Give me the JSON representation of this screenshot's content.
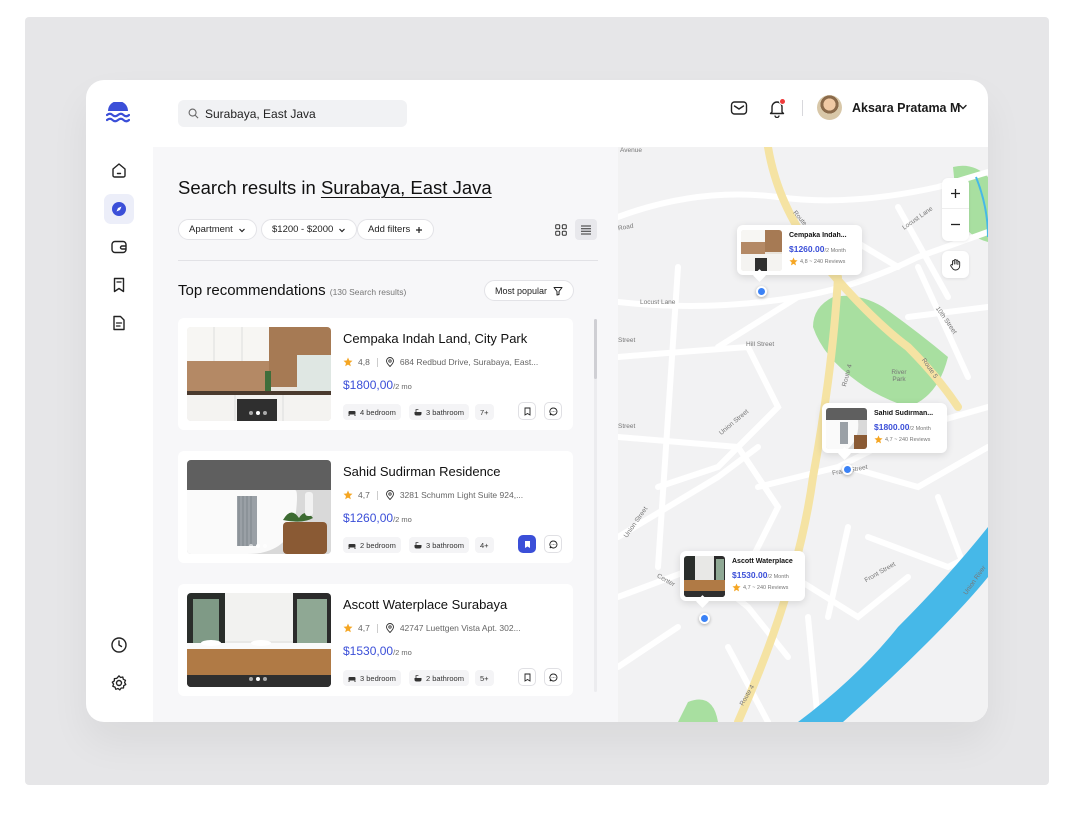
{
  "header": {
    "search_value": "Surabaya, East Java",
    "user_name": "Aksara Pratama M",
    "notification_dot": true
  },
  "sidebar": {
    "items": [
      {
        "icon": "home-icon",
        "active": false
      },
      {
        "icon": "compass-icon",
        "active": true
      },
      {
        "icon": "wallet-icon",
        "active": false
      },
      {
        "icon": "bookmark-icon",
        "active": false
      },
      {
        "icon": "document-icon",
        "active": false
      }
    ],
    "bottom": [
      {
        "icon": "clock-icon"
      },
      {
        "icon": "settings-icon"
      }
    ]
  },
  "results": {
    "title_prefix": "Search results in ",
    "location": "Surabaya, East Java",
    "filters": {
      "type": "Apartment",
      "price": "$1200 - $2000",
      "add": "Add filters"
    },
    "section_title": "Top recommendations",
    "result_count": "(130 Search results)",
    "sort_label": "Most popular"
  },
  "listings": [
    {
      "name": "Cempaka Indah Land, City Park",
      "rating": "4,8",
      "address": "684 Redbud Drive, Surabaya, East...",
      "price": "$1800,00",
      "period": "/2 mo",
      "bedroom": "4 bedroom",
      "bathroom": "3 bathroom",
      "more": "7+",
      "bookmarked": false
    },
    {
      "name": "Sahid Sudirman Residence",
      "rating": "4,7",
      "address": "3281 Schumm Light Suite 924,...",
      "price": "$1260,00",
      "period": "/2 mo",
      "bedroom": "2 bedroom",
      "bathroom": "3 bathroom",
      "more": "4+",
      "bookmarked": true
    },
    {
      "name": "Ascott Waterplace Surabaya",
      "rating": "4,7",
      "address": "42747 Luettgen Vista Apt. 302...",
      "price": "$1530,00",
      "period": "/2 mo",
      "bedroom": "3 bedroom",
      "bathroom": "2 bathroom",
      "more": "5+",
      "bookmarked": false
    }
  ],
  "map": {
    "streets": [
      "Avenue",
      "Road",
      "Locust Lane",
      "Locust Lane",
      "Hill Street",
      "Union Street",
      "Union Street",
      "Street",
      "Route 4",
      "Route 4",
      "Route 4",
      "River Park",
      "10th Street",
      "Route 5",
      "Frank Street",
      "Center",
      "Front Street",
      "Union River",
      "Street"
    ],
    "pins": [
      {
        "name": "Cempaka Indah...",
        "price": "$1260.00",
        "period": "/2 Month",
        "rating": "4,8 ~ 240 Reviews"
      },
      {
        "name": "Sahid Sudirman...",
        "price": "$1800.00",
        "period": "/2 Month",
        "rating": "4,7 ~ 240 Reviews"
      },
      {
        "name": "Ascott Waterplace",
        "price": "$1530.00",
        "period": "/2 Month",
        "rating": "4,7 ~ 240 Reviews"
      }
    ]
  },
  "colors": {
    "accent": "#3b4fd8",
    "star": "#f5a623",
    "river": "#46b8e8",
    "park": "#a8dfa0",
    "road_major": "#f5e3a3"
  }
}
